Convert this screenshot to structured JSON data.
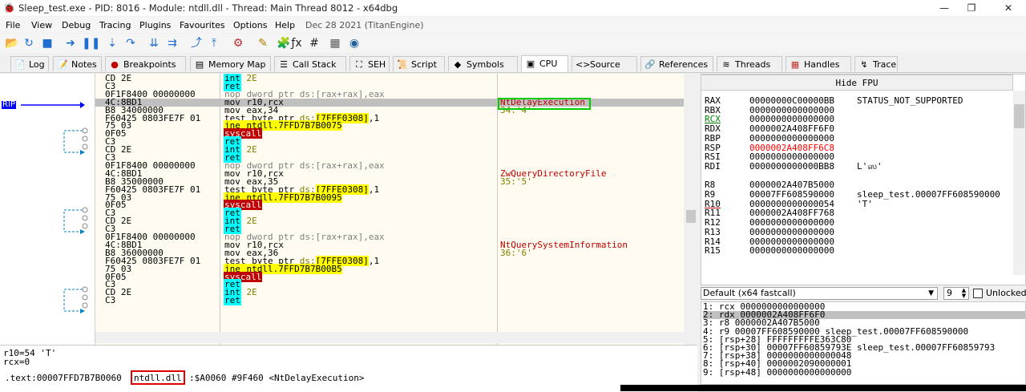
{
  "window": {
    "title": "Sleep_test.exe - PID: 8016 - Module: ntdll.dll - Thread: Main Thread 8012 - x64dbg",
    "controls": [
      "—",
      "❐",
      "✕"
    ]
  },
  "menu": {
    "items": [
      "File",
      "View",
      "Debug",
      "Tracing",
      "Plugins",
      "Favourites",
      "Options",
      "Help"
    ],
    "build_date": "Dec 28 2021 (TitanEngine)"
  },
  "toolbar": {
    "icons": [
      "open-icon",
      "restart-icon",
      "stop-icon",
      "run-icon",
      "pause-icon",
      "step-into-icon",
      "step-over-icon",
      "trace-into-icon",
      "trace-over-icon",
      "execute-till-return-icon",
      "run-to-user-code-icon",
      "preferences-icon",
      "highlight-icon",
      "patch-icon",
      "function-icon",
      "hash-icon",
      "calculator-icon",
      "about-icon"
    ],
    "glyphs": [
      "📂",
      "↻",
      "■",
      "➜",
      "❚❚",
      "⇣",
      "↷",
      "⇊",
      "⇉",
      "⤴",
      "⤒",
      "⚙",
      "✎",
      "🧩",
      "ƒx",
      "#",
      "▦",
      "◉"
    ],
    "colors": [
      "#c8a000",
      "#1f6fd0",
      "#1f6fd0",
      "#1f6fd0",
      "#1f6fd0",
      "#1f6fd0",
      "#1f6fd0",
      "#1f6fd0",
      "#1f6fd0",
      "#1f6fd0",
      "#1f6fd0",
      "#b03030",
      "#b08000",
      "#444444",
      "#222222",
      "#222222",
      "#555555",
      "#2060a0"
    ]
  },
  "tabs": [
    {
      "label": "Log",
      "icon": "log-icon",
      "glyph": "📄"
    },
    {
      "label": "Notes",
      "icon": "notes-icon",
      "glyph": "📝"
    },
    {
      "label": "Breakpoints",
      "icon": "breakpoints-icon",
      "glyph": "●"
    },
    {
      "label": "Memory Map",
      "icon": "memory-map-icon",
      "glyph": "▤"
    },
    {
      "label": "Call Stack",
      "icon": "call-stack-icon",
      "glyph": "☰"
    },
    {
      "label": "SEH",
      "icon": "seh-icon",
      "glyph": "⛶"
    },
    {
      "label": "Script",
      "icon": "script-icon",
      "glyph": "📜"
    },
    {
      "label": "Symbols",
      "icon": "symbols-icon",
      "glyph": "◆"
    },
    {
      "label": "CPU",
      "icon": "cpu-icon",
      "glyph": "▣"
    },
    {
      "label": "Source",
      "icon": "source-icon",
      "glyph": "<>"
    },
    {
      "label": "References",
      "icon": "references-icon",
      "glyph": "🔗"
    },
    {
      "label": "Threads",
      "icon": "threads-icon",
      "glyph": "≋"
    },
    {
      "label": "Handles",
      "icon": "handles-icon",
      "glyph": "▦"
    },
    {
      "label": "Trace",
      "icon": "trace-icon",
      "glyph": "↯"
    }
  ],
  "colors": {
    "rip_marker": "#0000ff",
    "green_box": "#00cc00",
    "red_box": "#e00000",
    "disasm_bg": "#fffbf0"
  },
  "rip_label": "RIP",
  "disasm": [
    {
      "bytes": "CD 2E",
      "mnem": "int",
      "mclass": "int",
      "ops": [
        {
          "t": " 2E",
          "c": "hx"
        }
      ]
    },
    {
      "bytes": "C3",
      "mnem": "ret",
      "mclass": "ret",
      "ops": []
    },
    {
      "bytes": "0F1F8400 00000000",
      "mnem": "nop",
      "mclass": "nop",
      "ops": [
        {
          "t": " dword ptr ds:[rax+rax],eax",
          "c": "gray"
        }
      ]
    },
    {
      "bytes": "4C:8BD1",
      "mnem": "mov",
      "mclass": "mov",
      "ops": [
        {
          "t": " r10,rcx",
          "c": ""
        }
      ],
      "comment": "NtDelayExecution",
      "cclass": "red",
      "cur": true
    },
    {
      "bytes": "B8 34000000",
      "mnem": "mov",
      "mclass": "mov",
      "ops": [
        {
          "t": " eax,34",
          "c": ""
        }
      ],
      "comment": "34:'4'",
      "cclass": "ch"
    },
    {
      "bytes": "F60425 0803FE7F 01",
      "mnem": "test",
      "mclass": "test",
      "ops": [
        {
          "t": " byte ptr ",
          "c": ""
        },
        {
          "t": "ds:",
          "c": "hx"
        },
        {
          "t": "[7FFE0308]",
          "c": "hl"
        },
        {
          "t": ",1",
          "c": ""
        }
      ]
    },
    {
      "bytes": "75 03",
      "mnem": "jne",
      "mclass": "jne",
      "ops": [
        {
          "t": " ntdll.7FFD7B7B0075",
          "c": "hl"
        }
      ]
    },
    {
      "bytes": "0F05",
      "mnem": "syscall",
      "mclass": "sys",
      "ops": []
    },
    {
      "bytes": "C3",
      "mnem": "ret",
      "mclass": "ret",
      "ops": []
    },
    {
      "bytes": "CD 2E",
      "mnem": "int",
      "mclass": "int",
      "ops": [
        {
          "t": " 2E",
          "c": "hx"
        }
      ]
    },
    {
      "bytes": "C3",
      "mnem": "ret",
      "mclass": "ret",
      "ops": []
    },
    {
      "bytes": "0F1F8400 00000000",
      "mnem": "nop",
      "mclass": "nop",
      "ops": [
        {
          "t": " dword ptr ds:[rax+rax],eax",
          "c": "gray"
        }
      ]
    },
    {
      "bytes": "4C:8BD1",
      "mnem": "mov",
      "mclass": "mov",
      "ops": [
        {
          "t": " r10,rcx",
          "c": ""
        }
      ],
      "comment": "ZwQueryDirectoryFile",
      "cclass": "red"
    },
    {
      "bytes": "B8 35000000",
      "mnem": "mov",
      "mclass": "mov",
      "ops": [
        {
          "t": " eax,35",
          "c": ""
        }
      ],
      "comment": "35:'5'",
      "cclass": "ch"
    },
    {
      "bytes": "F60425 0803FE7F 01",
      "mnem": "test",
      "mclass": "test",
      "ops": [
        {
          "t": " byte ptr ",
          "c": ""
        },
        {
          "t": "ds:",
          "c": "hx"
        },
        {
          "t": "[7FFE0308]",
          "c": "hl"
        },
        {
          "t": ",1",
          "c": ""
        }
      ]
    },
    {
      "bytes": "75 03",
      "mnem": "jne",
      "mclass": "jne",
      "ops": [
        {
          "t": " ntdll.7FFD7B7B0095",
          "c": "hl"
        }
      ]
    },
    {
      "bytes": "0F05",
      "mnem": "syscall",
      "mclass": "sys",
      "ops": []
    },
    {
      "bytes": "C3",
      "mnem": "ret",
      "mclass": "ret",
      "ops": []
    },
    {
      "bytes": "CD 2E",
      "mnem": "int",
      "mclass": "int",
      "ops": [
        {
          "t": " 2E",
          "c": "hx"
        }
      ]
    },
    {
      "bytes": "C3",
      "mnem": "ret",
      "mclass": "ret",
      "ops": []
    },
    {
      "bytes": "0F1F8400 00000000",
      "mnem": "nop",
      "mclass": "nop",
      "ops": [
        {
          "t": " dword ptr ds:[rax+rax],eax",
          "c": "gray"
        }
      ]
    },
    {
      "bytes": "4C:8BD1",
      "mnem": "mov",
      "mclass": "mov",
      "ops": [
        {
          "t": " r10,rcx",
          "c": ""
        }
      ],
      "comment": "NtQuerySystemInformation",
      "cclass": "red"
    },
    {
      "bytes": "B8 36000000",
      "mnem": "mov",
      "mclass": "mov",
      "ops": [
        {
          "t": " eax,36",
          "c": ""
        }
      ],
      "comment": "36:'6'",
      "cclass": "ch"
    },
    {
      "bytes": "F60425 0803FE7F 01",
      "mnem": "test",
      "mclass": "test",
      "ops": [
        {
          "t": " byte ptr ",
          "c": ""
        },
        {
          "t": "ds:",
          "c": "hx"
        },
        {
          "t": "[7FFE0308]",
          "c": "hl"
        },
        {
          "t": ",1",
          "c": ""
        }
      ]
    },
    {
      "bytes": "75 03",
      "mnem": "jne",
      "mclass": "jne",
      "ops": [
        {
          "t": " ntdll.7FFD7B7B00B5",
          "c": "hl"
        }
      ]
    },
    {
      "bytes": "0F05",
      "mnem": "syscall",
      "mclass": "sys",
      "ops": []
    },
    {
      "bytes": "C3",
      "mnem": "ret",
      "mclass": "ret",
      "ops": []
    },
    {
      "bytes": "CD 2E",
      "mnem": "int",
      "mclass": "int",
      "ops": [
        {
          "t": " 2E",
          "c": "hx"
        }
      ]
    },
    {
      "bytes": "C3",
      "mnem": "ret",
      "mclass": "ret",
      "ops": []
    }
  ],
  "info": {
    "line1": "r10=54 'T'",
    "line2": "rcx=0",
    "addr_prefix": ".text:00007FFD7B7B0060 ",
    "module": "ntdll.dll",
    "addr_suffix": ":$A0060 #9F460 <NtDelayExecution>"
  },
  "fpu_button": "Hide FPU",
  "registers": [
    {
      "name": "RAX",
      "value": "00000000C00000BB",
      "comment": "STATUS_NOT_SUPPORTED"
    },
    {
      "name": "RBX",
      "value": "0000000000000000",
      "comment": ""
    },
    {
      "name": "RCX",
      "value": "0000000000000000",
      "comment": "",
      "nstyle": "green"
    },
    {
      "name": "RDX",
      "value": "0000002A408FF6F0",
      "comment": ""
    },
    {
      "name": "RBP",
      "value": "0000000000000000",
      "comment": ""
    },
    {
      "name": "RSP",
      "value": "0000002A408FF6C8",
      "comment": "",
      "vstyle": "red"
    },
    {
      "name": "RSI",
      "value": "0000000000000000",
      "comment": ""
    },
    {
      "name": "RDI",
      "value": "0000000000000BB8",
      "comment": "L'ஸ'"
    },
    {
      "name": "",
      "value": "",
      "comment": ""
    },
    {
      "name": "R8",
      "value": "0000002A407B5000",
      "comment": ""
    },
    {
      "name": "R9",
      "value": "00007FF608590000",
      "comment": "sleep_test.00007FF608590000"
    },
    {
      "name": "R10",
      "value": "0000000000000054",
      "comment": "'T'",
      "nstyle": "ul"
    },
    {
      "name": "R11",
      "value": "0000002A408FF768",
      "comment": ""
    },
    {
      "name": "R12",
      "value": "0000000000000000",
      "comment": ""
    },
    {
      "name": "R13",
      "value": "0000000000000000",
      "comment": ""
    },
    {
      "name": "R14",
      "value": "0000000000000000",
      "comment": ""
    },
    {
      "name": "R15",
      "value": "0000000000000000",
      "comment": ""
    }
  ],
  "callconv": {
    "selected": "Default (x64 fastcall)",
    "arg_count": "9",
    "unlocked_label": "Unlocked"
  },
  "stack_args": [
    {
      "text": "1: rcx 0000000000000000",
      "sel": false
    },
    {
      "text": "2: rdx 0000002A408FF6F0",
      "sel": true
    },
    {
      "text": "3: r8 0000002A407B5000",
      "sel": false
    },
    {
      "text": "4: r9 00007FF608590000 sleep_test.00007FF608590000",
      "sel": false
    },
    {
      "text": "5: [rsp+28] FFFFFFFFFE363C80",
      "sel": false
    },
    {
      "text": "6: [rsp+30] 00007FF60859793E sleep_test.00007FF60859793",
      "sel": false
    },
    {
      "text": "7: [rsp+38] 0000000000000048",
      "sel": false
    },
    {
      "text": "8: [rsp+40] 0000002090000001",
      "sel": false
    },
    {
      "text": "9: [rsp+48] 0000000000000000",
      "sel": false
    }
  ]
}
